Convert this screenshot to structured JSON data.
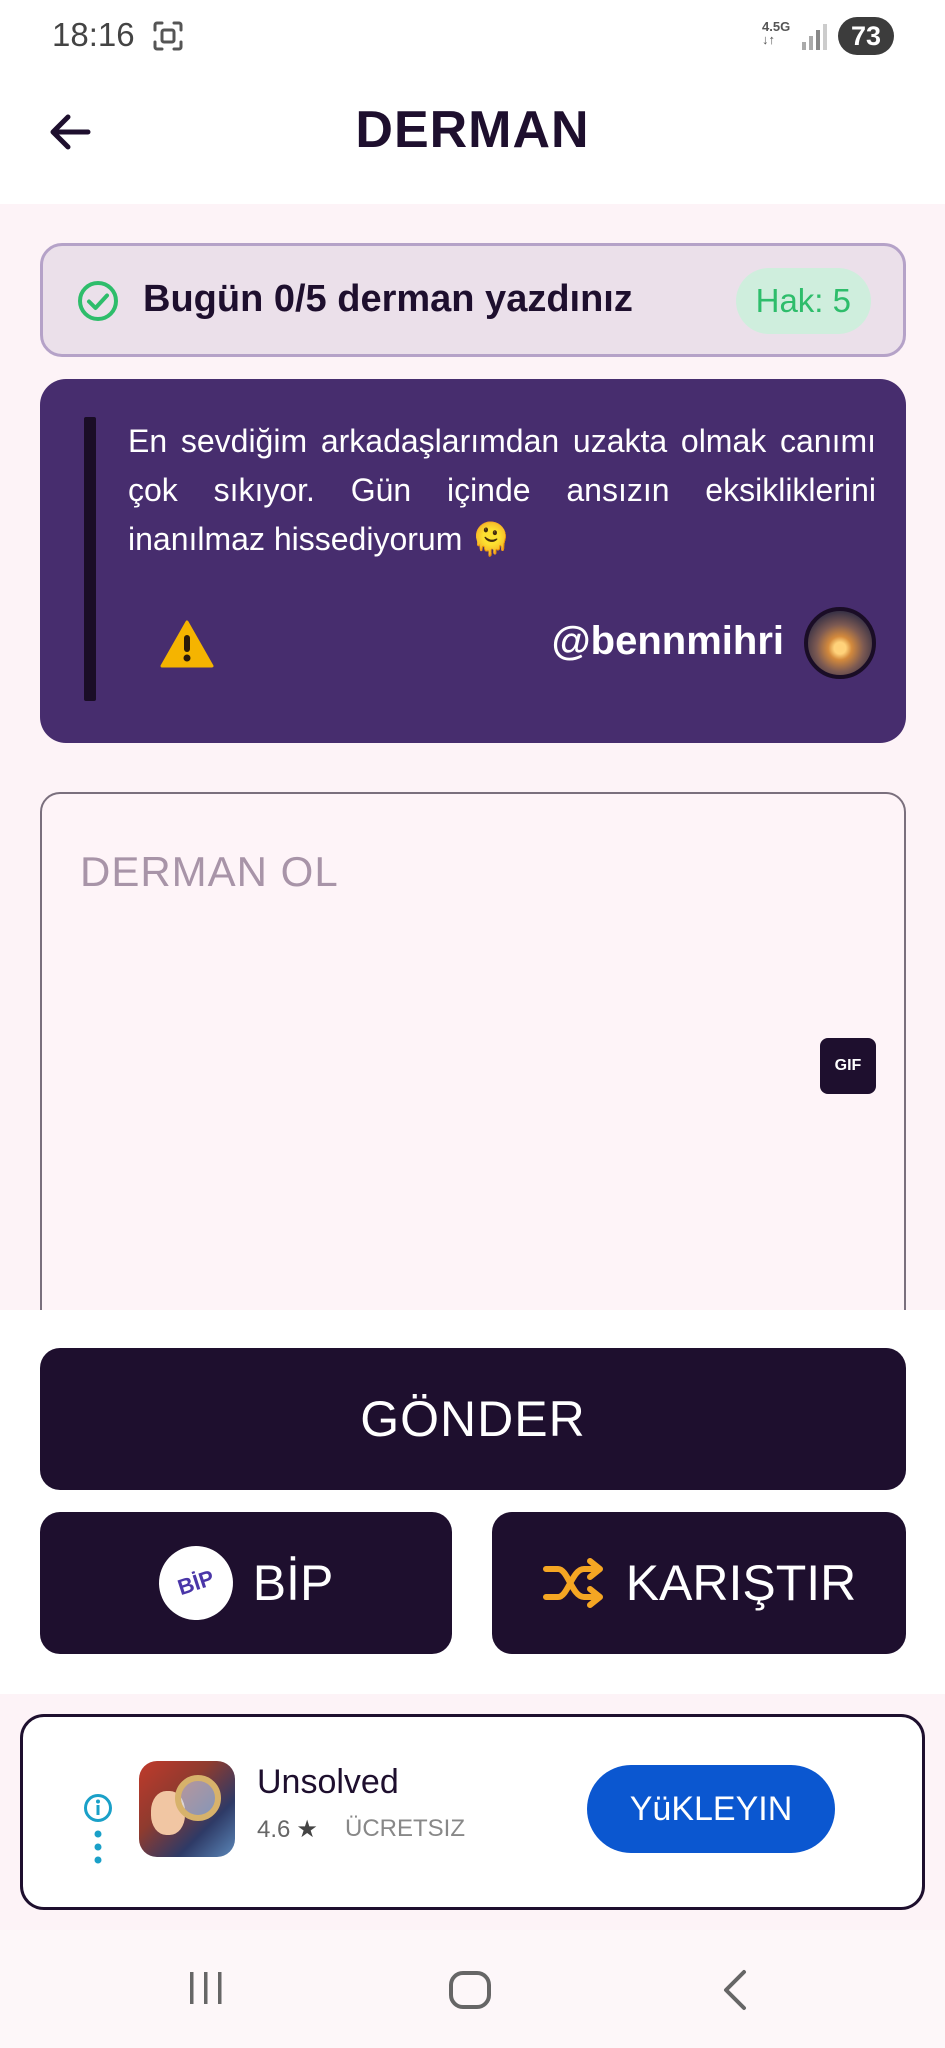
{
  "status_bar": {
    "time": "18:16",
    "network_top": "4.5G",
    "network_bottom": "↓↑",
    "battery": "73"
  },
  "header": {
    "title": "DERMAN"
  },
  "counter": {
    "text": "Bugün 0/5 derman yazdınız",
    "quota": "Hak: 5",
    "accent_color": "#2ebd6b"
  },
  "message": {
    "text": "En sevdiğim arkadaşlarımdan uzakta olmak canımı çok sıkıyor. Gün içinde ansızın eksikliklerini inanılmaz hissediyorum 🫠",
    "username": "@bennmihri",
    "card_color": "#472d6e"
  },
  "reply": {
    "placeholder": "DERMAN OL",
    "gif_label": "GIF"
  },
  "actions": {
    "send_label": "GÖNDER",
    "bip_label": "BİP",
    "bip_logo_text": "BİP",
    "shuffle_label": "KARIŞTIR",
    "button_color": "#1e0f2e"
  },
  "ad": {
    "app_name": "Unsolved",
    "rating": "4.6",
    "rating_star": "★",
    "price": "ÜCRETSIZ",
    "install_label": "YüKLEYIN",
    "install_color": "#0b57d0"
  },
  "icons": {
    "back": "arrow-left-icon",
    "check": "check-circle-icon",
    "warning": "warning-icon",
    "shuffle": "shuffle-icon",
    "info": "info-icon"
  }
}
